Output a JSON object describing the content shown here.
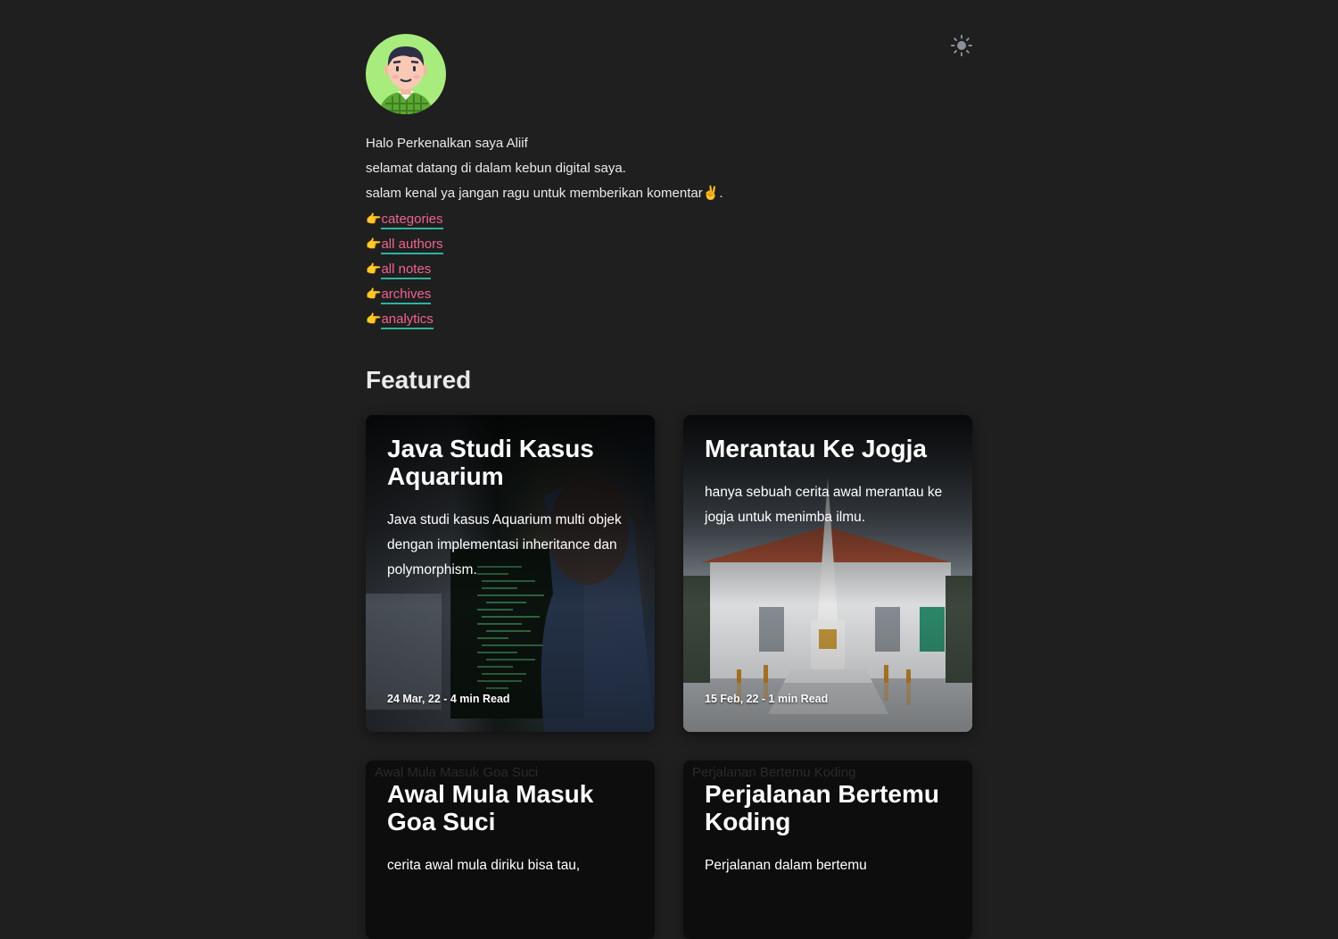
{
  "profile": {
    "avatar_icon": "avatar-illustration",
    "theme_toggle_icon": "sun-icon"
  },
  "intro": {
    "line1": "Halo Perkenalkan saya Aliif",
    "line2": "selamat datang di dalam kebun digital saya.",
    "line3": "salam kenal ya jangan ragu untuk memberikan komentar",
    "line3_emoji": "✌️",
    "line3_end": ".",
    "pointer_emoji": "👉"
  },
  "links": [
    {
      "label": "categories"
    },
    {
      "label": "all authors"
    },
    {
      "label": "all notes"
    },
    {
      "label": "archives"
    },
    {
      "label": "analytics"
    }
  ],
  "featured": {
    "heading": "Featured",
    "cards": [
      {
        "title": "Java Studi Kasus Aquarium",
        "description": "Java studi kasus Aquarium multi objek dengan implementasi inheritance dan polymorphism.",
        "meta": "24 Mar, 22 - 4 min Read",
        "image": "programmer-at-monitor-photo"
      },
      {
        "title": "Merantau Ke Jogja",
        "description": "hanya sebuah cerita awal merantau ke jogja untuk menimba ilmu.",
        "meta": "15 Feb, 22 - 1 min Read",
        "image": "tugu-jogja-photo"
      },
      {
        "title": "Awal Mula Masuk Goa Suci",
        "description": "cerita awal mula diriku bisa tau,",
        "alt": "Awal Mula Masuk Goa Suci"
      },
      {
        "title": "Perjalanan Bertemu Koding",
        "description": "Perjalanan dalam bertemu",
        "alt": "Perjalanan Bertemu Koding"
      }
    ]
  },
  "colors": {
    "background": "#1f1f1f",
    "link": "#f06292",
    "link_underline": "#2bb3a3",
    "avatar_bg": "#a8ec7d"
  }
}
